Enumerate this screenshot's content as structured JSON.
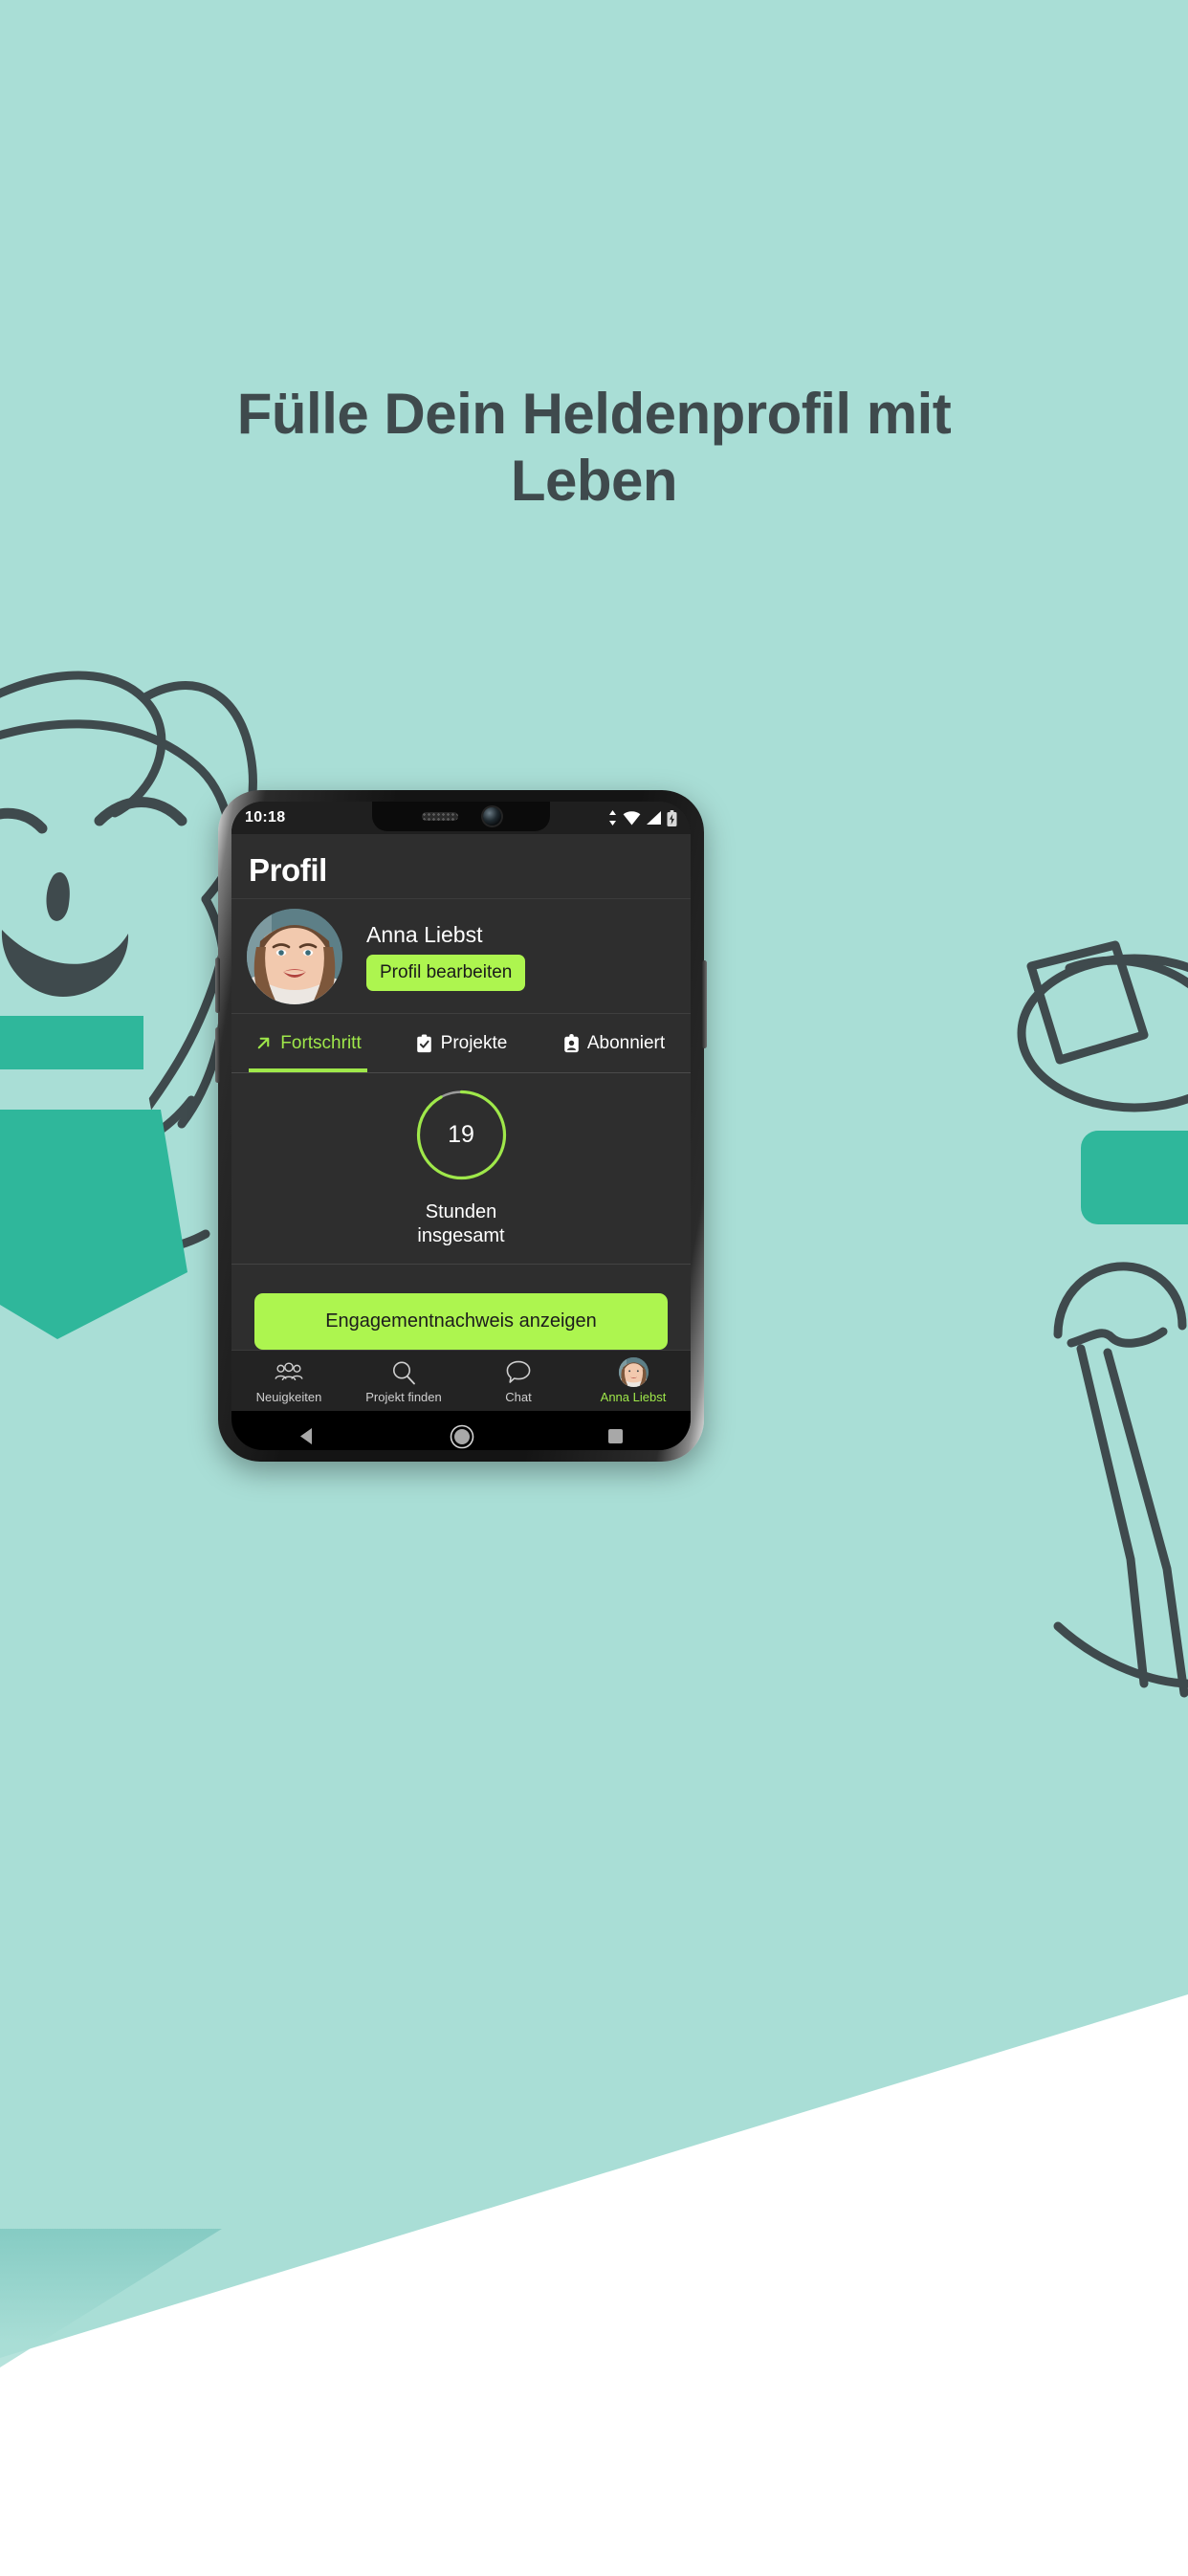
{
  "promo": {
    "headline": "Fülle Dein Heldenprofil mit Leben",
    "background_color": "#a9ded6",
    "headline_color": "#3f4a4d",
    "lower_band_color": "#ffffff"
  },
  "phone": {
    "statusbar": {
      "time": "10:18",
      "icons": [
        "data-transfer-icon",
        "wifi-icon",
        "signal-icon",
        "battery-charging-icon"
      ]
    },
    "android_nav": {
      "back": "back-triangle-icon",
      "home": "home-circle-icon",
      "recents": "recents-square-icon"
    }
  },
  "app": {
    "accent_color": "#adf54f",
    "surface_color": "#2e2e2e",
    "header": {
      "title": "Profil"
    },
    "profile": {
      "name": "Anna Liebst",
      "avatar": "user-avatar",
      "edit_button": "Profil bearbeiten"
    },
    "tabs": [
      {
        "label": "Fortschritt",
        "icon": "arrow-up-right-icon",
        "active": true
      },
      {
        "label": "Projekte",
        "icon": "clipboard-check-icon",
        "active": false
      },
      {
        "label": "Abonniert",
        "icon": "id-badge-icon",
        "active": false
      }
    ],
    "progress": {
      "value": "19",
      "caption_line1": "Stunden",
      "caption_line2": "insgesamt",
      "ring_color": "#9fe84a",
      "ring_track_color": "#9a9a9a",
      "ring_percent": 92
    },
    "cta": {
      "label": "Engagementnachweis anzeigen"
    },
    "bottom_nav": [
      {
        "label": "Neuigkeiten",
        "icon": "group-people-icon",
        "active": false
      },
      {
        "label": "Projekt finden",
        "icon": "search-icon",
        "active": false
      },
      {
        "label": "Chat",
        "icon": "speech-bubble-icon",
        "active": false
      },
      {
        "label": "Anna Liebst",
        "icon": "user-avatar-icon",
        "active": true
      }
    ]
  }
}
